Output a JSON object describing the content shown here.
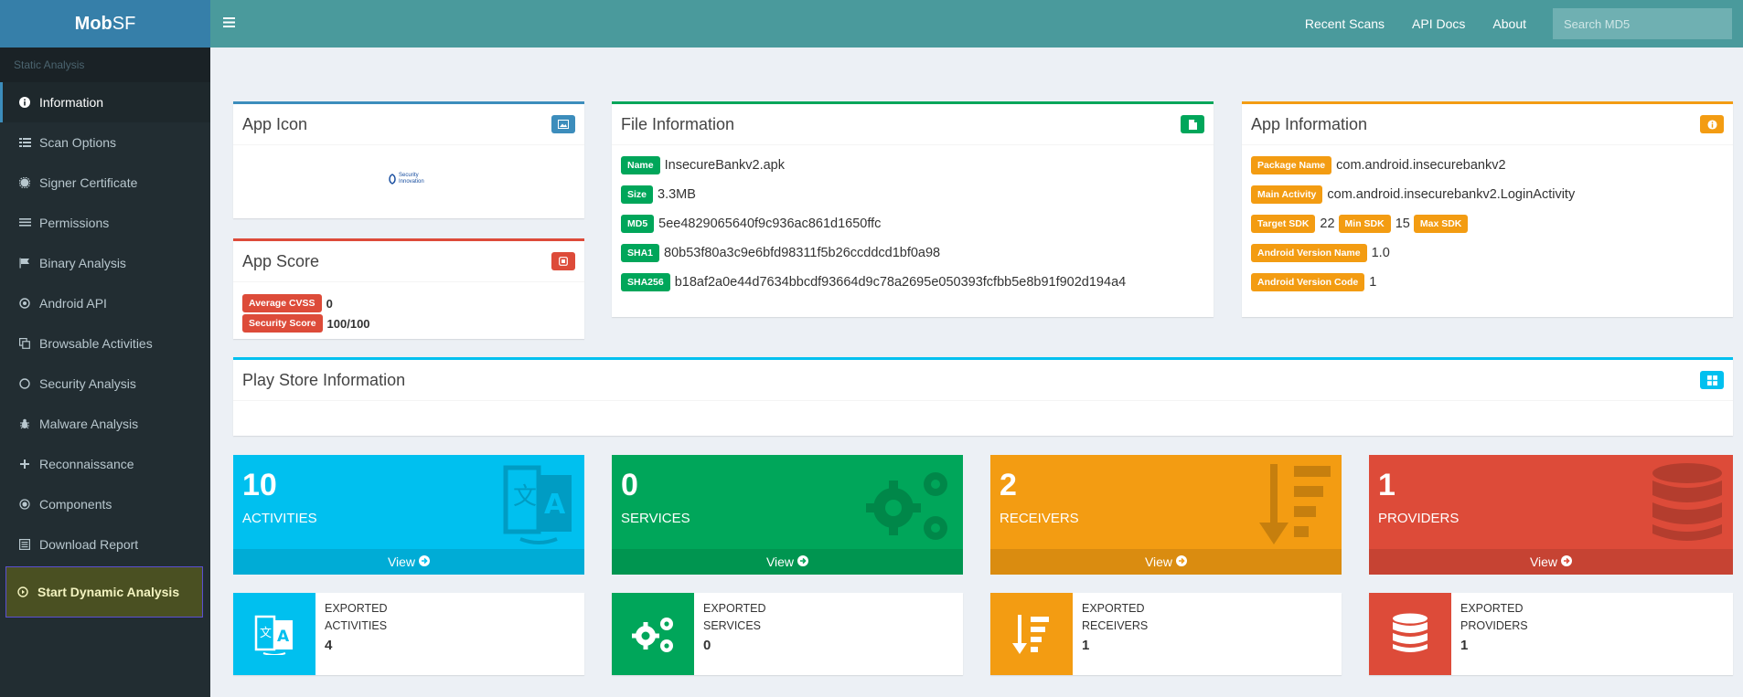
{
  "app": {
    "logo_bold": "Mob",
    "logo_light": "SF"
  },
  "header": {
    "links": [
      "Recent Scans",
      "API Docs",
      "About"
    ],
    "search_placeholder": "Search MD5"
  },
  "sidebar": {
    "section": "Static Analysis",
    "items": [
      {
        "label": "Information",
        "icon": "info-circle-icon"
      },
      {
        "label": "Scan Options",
        "icon": "list-icon"
      },
      {
        "label": "Signer Certificate",
        "icon": "certificate-icon"
      },
      {
        "label": "Permissions",
        "icon": "list-lines-icon"
      },
      {
        "label": "Binary Analysis",
        "icon": "flag-icon"
      },
      {
        "label": "Android API",
        "icon": "dot-circle-icon"
      },
      {
        "label": "Browsable Activities",
        "icon": "clone-icon"
      },
      {
        "label": "Security Analysis",
        "icon": "circle-icon"
      },
      {
        "label": "Malware Analysis",
        "icon": "bug-icon"
      },
      {
        "label": "Reconnaissance",
        "icon": "plus-icon"
      },
      {
        "label": "Components",
        "icon": "target-icon"
      },
      {
        "label": "Download Report",
        "icon": "report-icon"
      }
    ],
    "dynamic": {
      "label": "Start Dynamic Analysis",
      "icon": "play-circle-icon"
    }
  },
  "app_icon_box": {
    "title": "App Icon",
    "logo_text": "Security Innovation"
  },
  "app_score_box": {
    "title": "App Score",
    "avg_cvss_label": "Average CVSS",
    "avg_cvss_value": "0",
    "security_score_label": "Security Score",
    "security_score_value": "100/100"
  },
  "file_info": {
    "title": "File Information",
    "rows": [
      {
        "label": "Name",
        "value": "InsecureBankv2.apk"
      },
      {
        "label": "Size",
        "value": "3.3MB"
      },
      {
        "label": "MD5",
        "value": "5ee4829065640f9c936ac861d1650ffc"
      },
      {
        "label": "SHA1",
        "value": "80b53f80a3c9e6bfd98311f5b26ccddcd1bf0a98"
      },
      {
        "label": "SHA256",
        "value": "b18af2a0e44d7634bbcdf93664d9c78a2695e050393fcfbb5e8b91f902d194a4"
      }
    ]
  },
  "app_info": {
    "title": "App Information",
    "package_label": "Package Name",
    "package_value": "com.android.insecurebankv2",
    "main_activity_label": "Main Activity",
    "main_activity_value": "com.android.insecurebankv2.LoginActivity",
    "target_sdk_label": "Target SDK",
    "target_sdk_value": "22",
    "min_sdk_label": "Min SDK",
    "min_sdk_value": "15",
    "max_sdk_label": "Max SDK",
    "version_name_label": "Android Version Name",
    "version_name_value": "1.0",
    "version_code_label": "Android Version Code",
    "version_code_value": "1"
  },
  "play_store": {
    "title": "Play Store Information"
  },
  "stats": [
    {
      "count": "10",
      "caption": "ACTIVITIES",
      "footer": "View",
      "color": "#00c0ef",
      "icon": "language-icon"
    },
    {
      "count": "0",
      "caption": "SERVICES",
      "footer": "View",
      "color": "#00a65a",
      "icon": "cogs-icon"
    },
    {
      "count": "2",
      "caption": "RECEIVERS",
      "footer": "View",
      "color": "#f39c12",
      "icon": "sort-amount-down-icon"
    },
    {
      "count": "1",
      "caption": "PROVIDERS",
      "footer": "View",
      "color": "#dd4b39",
      "icon": "database-icon"
    }
  ],
  "exported": [
    {
      "line1": "EXPORTED",
      "line2": "ACTIVITIES",
      "count": "4",
      "color": "#00c0ef",
      "icon": "language-icon"
    },
    {
      "line1": "EXPORTED",
      "line2": "SERVICES",
      "count": "0",
      "color": "#00a65a",
      "icon": "cogs-icon"
    },
    {
      "line1": "EXPORTED",
      "line2": "RECEIVERS",
      "count": "1",
      "color": "#f39c12",
      "icon": "sort-amount-down-icon"
    },
    {
      "line1": "EXPORTED",
      "line2": "PROVIDERS",
      "count": "1",
      "color": "#dd4b39",
      "icon": "database-icon"
    }
  ]
}
